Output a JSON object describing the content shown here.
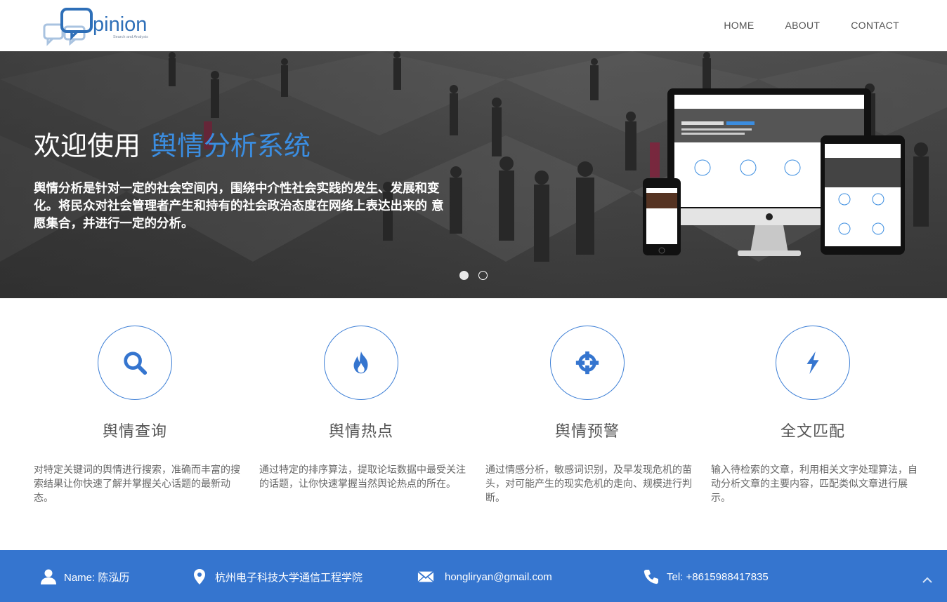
{
  "header": {
    "logo_text": "pinion",
    "logo_tagline": "Search and Analysis",
    "nav": [
      {
        "label": "HOME"
      },
      {
        "label": "ABOUT"
      },
      {
        "label": "CONTACT"
      }
    ]
  },
  "hero": {
    "title_prefix": "欢迎使用",
    "title_accent": "舆情分析系统",
    "description": "舆情分析是针对一定的社会空间内，围绕中介性社会实践的发生、发展和变化。将民众对社会管理者产生和持有的社会政治态度在网络上表达出来的 意愿集合，并进行一定的分析。",
    "slides": [
      {
        "active": true
      },
      {
        "active": false
      }
    ],
    "devices_image": "responsive-devices-mockup"
  },
  "features": [
    {
      "icon": "search-icon",
      "title": "舆情查询",
      "text": "对特定关键词的舆情进行搜索，准确而丰富的搜索结果让你快速了解并掌握关心话题的最新动态。"
    },
    {
      "icon": "fire-icon",
      "title": "舆情热点",
      "text": "通过特定的排序算法，提取论坛数据中最受关注的话题，让你快速掌握当然舆论热点的所在。"
    },
    {
      "icon": "crosshair-icon",
      "title": "舆情预警",
      "text": "通过情感分析，敏感词识别，及早发现危机的苗头，对可能产生的现实危机的走向、规模进行判断。"
    },
    {
      "icon": "bolt-icon",
      "title": "全文匹配",
      "text": "输入待检索的文章，利用相关文字处理算法，自动分析文章的主要内容，匹配类似文章进行展示。"
    }
  ],
  "footer": {
    "name": "Name: 陈泓历",
    "address": "杭州电子科技大学通信工程学院",
    "email": "hongliryan@gmail.com",
    "tel": "Tel: +8615988417835"
  },
  "colors": {
    "accent": "#3b8de0",
    "footer_bg": "#3575cf",
    "icon_blue": "#3575cf"
  }
}
